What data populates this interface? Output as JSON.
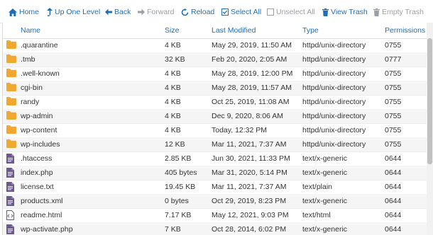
{
  "toolbar": {
    "home": "Home",
    "up_one_level": "Up One Level",
    "back": "Back",
    "forward": "Forward",
    "reload": "Reload",
    "select_all": "Select All",
    "unselect_all": "Unselect All",
    "view_trash": "View Trash",
    "empty_trash": "Empty Trash"
  },
  "columns": {
    "name": "Name",
    "size": "Size",
    "modified": "Last Modified",
    "type": "Type",
    "permissions": "Permissions"
  },
  "colors": {
    "accent": "#1e6fb9",
    "folder": "#f0a830",
    "file": "#6b5a8e",
    "disabled": "#9aa0a6"
  },
  "files": [
    {
      "icon": "folder-icon",
      "name": ".quarantine",
      "size": "4 KB",
      "modified": "May 29, 2019, 11:50 AM",
      "type": "httpd/unix-directory",
      "perms": "0755"
    },
    {
      "icon": "folder-icon",
      "name": ".tmb",
      "size": "32 KB",
      "modified": "Feb 20, 2020, 2:05 AM",
      "type": "httpd/unix-directory",
      "perms": "0777"
    },
    {
      "icon": "folder-icon",
      "name": ".well-known",
      "size": "4 KB",
      "modified": "May 28, 2019, 12:00 PM",
      "type": "httpd/unix-directory",
      "perms": "0755"
    },
    {
      "icon": "folder-icon",
      "name": "cgi-bin",
      "size": "4 KB",
      "modified": "May 28, 2019, 11:57 AM",
      "type": "httpd/unix-directory",
      "perms": "0755"
    },
    {
      "icon": "folder-icon",
      "name": "randy",
      "size": "4 KB",
      "modified": "Oct 25, 2019, 11:08 AM",
      "type": "httpd/unix-directory",
      "perms": "0755"
    },
    {
      "icon": "folder-icon",
      "name": "wp-admin",
      "size": "4 KB",
      "modified": "Dec 9, 2020, 8:06 AM",
      "type": "httpd/unix-directory",
      "perms": "0755"
    },
    {
      "icon": "folder-icon",
      "name": "wp-content",
      "size": "4 KB",
      "modified": "Today, 12:32 PM",
      "type": "httpd/unix-directory",
      "perms": "0755"
    },
    {
      "icon": "folder-icon",
      "name": "wp-includes",
      "size": "12 KB",
      "modified": "Mar 11, 2021, 7:37 AM",
      "type": "httpd/unix-directory",
      "perms": "0755"
    },
    {
      "icon": "file-icon",
      "name": ".htaccess",
      "size": "2.85 KB",
      "modified": "Jun 30, 2021, 11:33 PM",
      "type": "text/x-generic",
      "perms": "0644"
    },
    {
      "icon": "file-icon",
      "name": "index.php",
      "size": "405 bytes",
      "modified": "Mar 31, 2020, 5:14 PM",
      "type": "text/x-generic",
      "perms": "0644"
    },
    {
      "icon": "file-icon",
      "name": "license.txt",
      "size": "19.45 KB",
      "modified": "Mar 11, 2021, 7:37 AM",
      "type": "text/plain",
      "perms": "0644"
    },
    {
      "icon": "file-icon",
      "name": "products.xml",
      "size": "0 bytes",
      "modified": "Oct 29, 2019, 8:23 PM",
      "type": "text/x-generic",
      "perms": "0644"
    },
    {
      "icon": "html-file-icon",
      "name": "readme.html",
      "size": "7.17 KB",
      "modified": "May 12, 2021, 9:03 PM",
      "type": "text/html",
      "perms": "0644"
    },
    {
      "icon": "file-icon",
      "name": "wp-activate.php",
      "size": "7 KB",
      "modified": "Oct 28, 2014, 6:02 PM",
      "type": "text/x-generic",
      "perms": "0644"
    }
  ]
}
